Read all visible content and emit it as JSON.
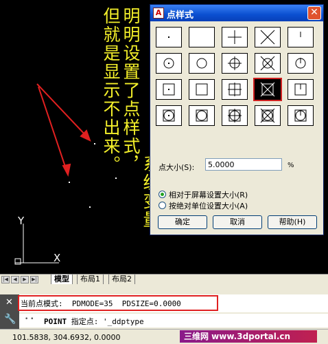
{
  "annotation": {
    "column1": "但就是显示不出来。",
    "column2": "明明设置了点样式，",
    "column3": "系统变量，"
  },
  "ucs": {
    "y_label": "Y",
    "x_label": "X"
  },
  "dialog": {
    "title": "点样式",
    "title_icon_letter": "A",
    "close_label": "✕",
    "selected_style_index": 13,
    "size_label": "点大小(S):",
    "size_value": "5.0000",
    "size_unit": "%",
    "radio_relative": "相对于屏幕设置大小(R)",
    "radio_absolute": "按绝对单位设置大小(A)",
    "radio_selected": "relative",
    "ok_label": "确定",
    "cancel_label": "取消",
    "help_label": "帮助(H)"
  },
  "tabs": {
    "nav": [
      "|◀",
      "◀",
      "▶",
      "▶|"
    ],
    "model": "模型",
    "layout1": "布局1",
    "layout2": "布局2"
  },
  "command": {
    "history": "当前点模式:  PDMODE=35  PDSIZE=0.0000",
    "prompt_dots": "• •",
    "prompt_keyword": "POINT",
    "prompt_text": " 指定点: '_ddptype"
  },
  "status": {
    "coords": "101.5838, 304.6932, 0.0000",
    "watermark": "三维网 www.3dportal.cn"
  },
  "colors": {
    "annotation": "#f3ef2a",
    "arrow": "#e02020",
    "highlight": "#e02020",
    "selected_cell_bg": "#000000"
  }
}
